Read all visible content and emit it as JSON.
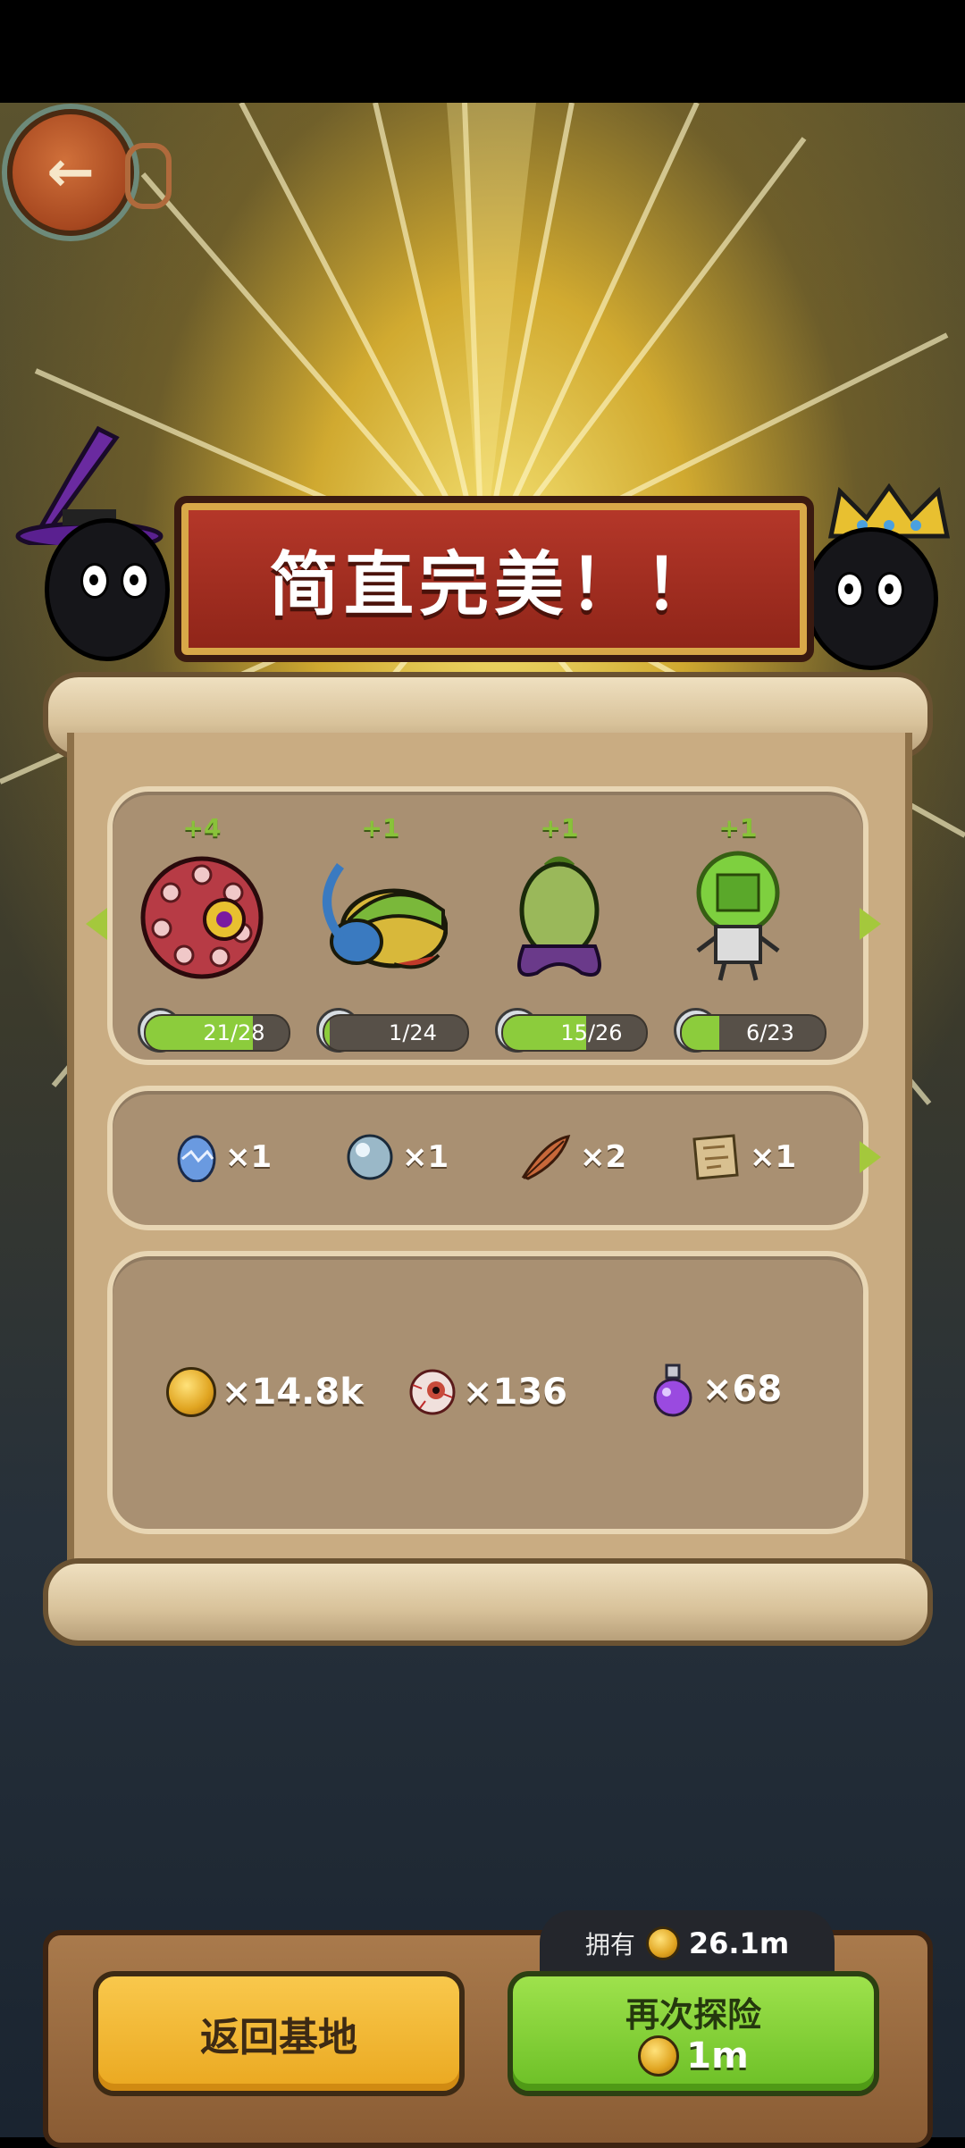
{
  "result_title": "简直完美！！",
  "creatures": [
    {
      "gain": "+4",
      "progress_text": "21/28",
      "progress": 0.75
    },
    {
      "gain": "+1",
      "progress_text": "1/24",
      "progress": 0.04
    },
    {
      "gain": "+1",
      "progress_text": "15/26",
      "progress": 0.58
    },
    {
      "gain": "+1",
      "progress_text": "6/23",
      "progress": 0.26
    }
  ],
  "items": [
    {
      "icon": "egg-icon",
      "count": "×1"
    },
    {
      "icon": "pearl-icon",
      "count": "×1"
    },
    {
      "icon": "feather-icon",
      "count": "×2"
    },
    {
      "icon": "map-scroll-icon",
      "count": "×1"
    }
  ],
  "resources": [
    {
      "icon": "gold-coin-icon",
      "count": "×14.8k"
    },
    {
      "icon": "eyeball-icon",
      "count": "×136"
    },
    {
      "icon": "potion-icon",
      "count": "×68"
    }
  ],
  "buttons": {
    "home_label": "返回基地",
    "again_label": "再次探险",
    "again_cost": "1m"
  },
  "owned": {
    "label": "拥有",
    "value": "26.1m"
  },
  "colors": {
    "banner": "#a02c1e",
    "primary_button": "#8fd63c",
    "secondary_button": "#f2b830"
  }
}
